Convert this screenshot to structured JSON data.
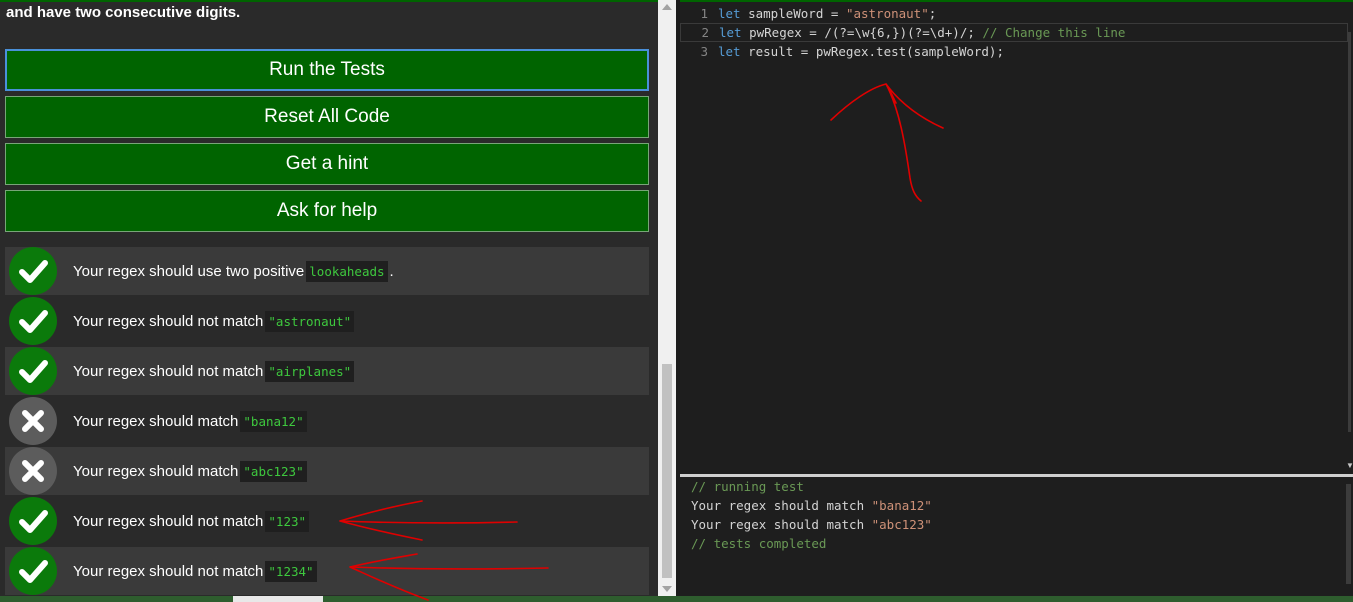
{
  "instructions": {
    "intro_text": "and have two consecutive digits."
  },
  "buttons": {
    "run": "Run the Tests",
    "reset": "Reset All Code",
    "hint": "Get a hint",
    "help": "Ask for help"
  },
  "tests": [
    {
      "status": "pass",
      "text": "Your regex should use two positive",
      "code": "lookaheads",
      "trail": "."
    },
    {
      "status": "pass",
      "text": "Your regex should not match",
      "code": "\"astronaut\"",
      "trail": ""
    },
    {
      "status": "pass",
      "text": "Your regex should not match",
      "code": "\"airplanes\"",
      "trail": ""
    },
    {
      "status": "fail",
      "text": "Your regex should match",
      "code": "\"bana12\"",
      "trail": ""
    },
    {
      "status": "fail",
      "text": "Your regex should match",
      "code": "\"abc123\"",
      "trail": ""
    },
    {
      "status": "pass",
      "text": "Your regex should not match",
      "code": "\"123\"",
      "trail": ""
    },
    {
      "status": "pass",
      "text": "Your regex should not match",
      "code": "\"1234\"",
      "trail": ""
    }
  ],
  "editor": {
    "lines": [
      {
        "num": "1",
        "kw": "let",
        "code": " sampleWord = ",
        "str": "\"astronaut\"",
        "rest": ";",
        "comment": ""
      },
      {
        "num": "2",
        "kw": "let",
        "code": " pwRegex = /(?=\\w{6,})(?=\\d+)/; ",
        "str": "",
        "rest": "",
        "comment": "// Change this line"
      },
      {
        "num": "3",
        "kw": "let",
        "code": " result = pwRegex.test(sampleWord);",
        "str": "",
        "rest": "",
        "comment": ""
      }
    ]
  },
  "console": {
    "running": "// running test",
    "line1_text": "Your regex should match ",
    "line1_str": "\"bana12\"",
    "line2_text": "Your regex should match ",
    "line2_str": "\"abc123\"",
    "completed": "// tests completed"
  },
  "colors": {
    "button_green": "#006400",
    "pass_green": "#0b7a0b",
    "fail_gray": "#5c5c5c",
    "code_green": "#3ec83e",
    "annotation_red": "#e00000"
  }
}
